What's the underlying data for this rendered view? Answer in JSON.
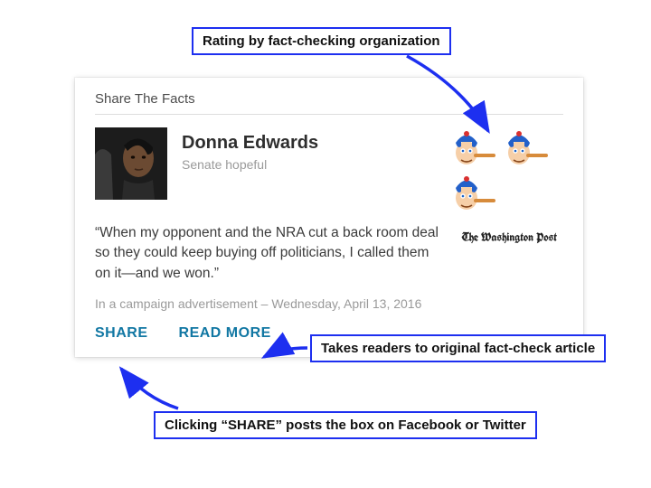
{
  "card": {
    "title": "Share The Facts",
    "person_name": "Donna Edwards",
    "person_subtitle": "Senate hopeful",
    "quote": "“When my opponent and the NRA cut a back room deal so they could keep buying off politicians, I called them on it—and we won.”",
    "context": "In a campaign advertisement – Wednesday, April 13, 2016",
    "outlet": "The Washington Post",
    "rating_icon": "pinocchio-icon",
    "rating_count": 3,
    "actions": {
      "share": "SHARE",
      "read_more": "READ MORE"
    }
  },
  "annotations": {
    "rating": "Rating by fact-checking organization",
    "readmore": "Takes readers to original fact-check article",
    "share": "Clicking “SHARE” posts the box on Facebook or Twitter"
  }
}
